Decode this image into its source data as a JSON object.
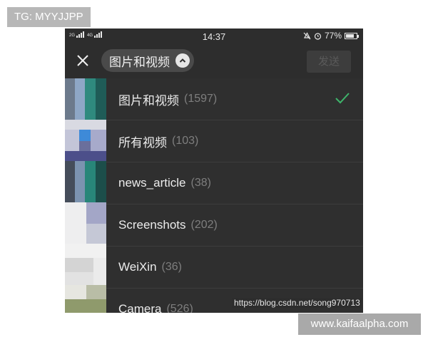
{
  "overlay": {
    "tg_badge": "TG: MYYJJPP",
    "csdn_url": "https://blog.csdn.net/song970713",
    "site_watermark": "www.kaifaalpha.com"
  },
  "status_bar": {
    "signal_labels": [
      "2G",
      "4G"
    ],
    "time": "14:37",
    "battery_percent": "77%",
    "battery_level": 0.77,
    "icons": [
      "signal-icon",
      "mute-icon",
      "alarm-icon",
      "battery-icon"
    ]
  },
  "toolbar": {
    "close_icon": "close-icon",
    "album_title": "图片和视频",
    "dropdown_icon": "chevron-up-icon",
    "send_label": "发送"
  },
  "albums": [
    {
      "name": "图片和视频",
      "count": "(1597)",
      "selected": true
    },
    {
      "name": "所有视频",
      "count": "(103)",
      "selected": false
    },
    {
      "name": "news_article",
      "count": "(38)",
      "selected": false
    },
    {
      "name": "Screenshots",
      "count": "(202)",
      "selected": false
    },
    {
      "name": "WeiXin",
      "count": "(36)",
      "selected": false
    },
    {
      "name": "Camera",
      "count": "(526)",
      "selected": false
    }
  ],
  "colors": {
    "background": "#2d2d2d",
    "check_green": "#3fb56b",
    "count_gray": "#7e7e7e"
  }
}
